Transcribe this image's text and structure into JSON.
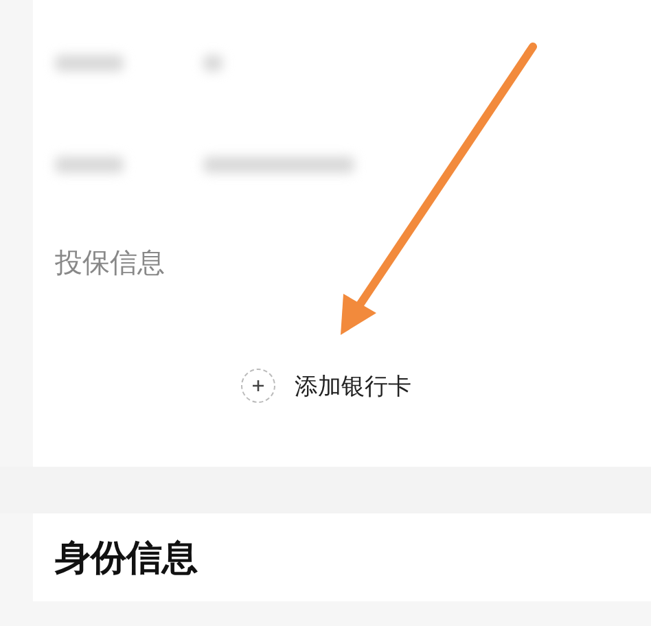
{
  "insured_section": {
    "title": "投保信息",
    "add_button": {
      "label": "添加银行卡"
    }
  },
  "identity_section": {
    "title": "身份信息"
  }
}
